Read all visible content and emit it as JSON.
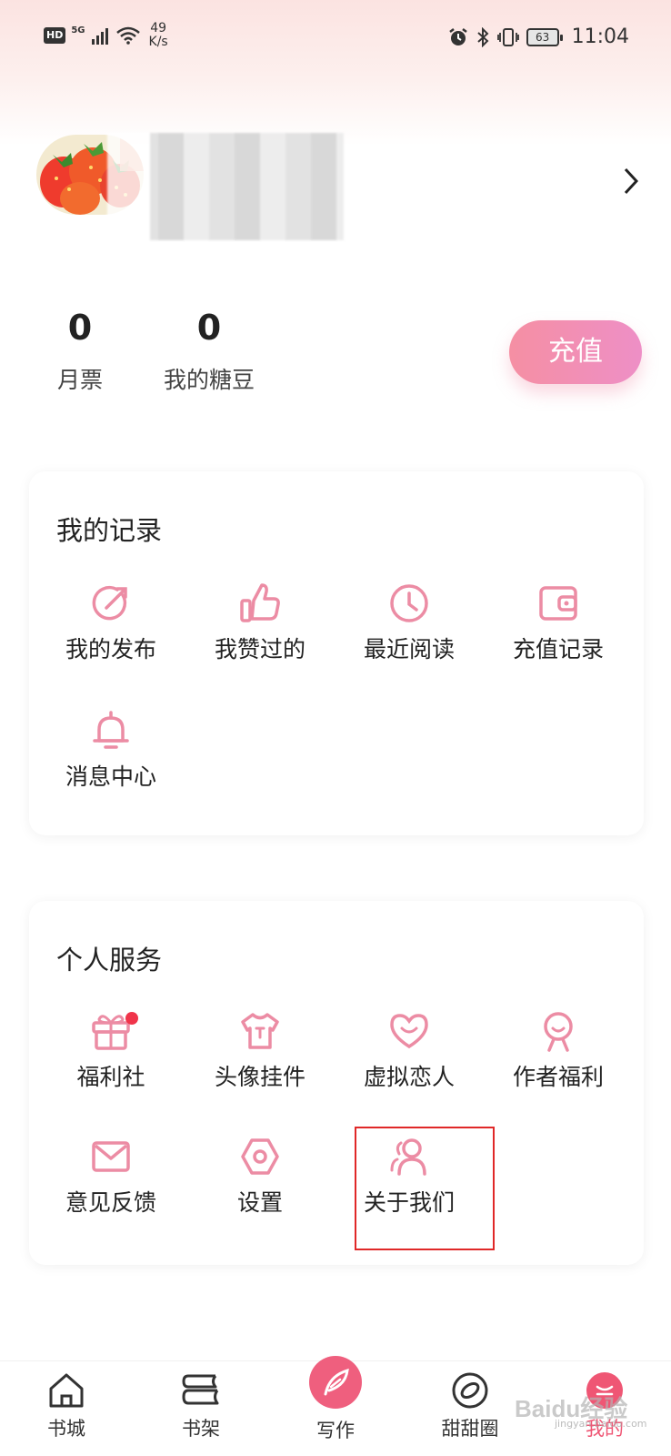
{
  "status_bar": {
    "hd": "HD",
    "network": "5G",
    "speed_value": "49",
    "speed_unit": "K/s",
    "battery": "63",
    "time": "11:04"
  },
  "profile": {
    "avatar_icon": "strawberry-avatar",
    "chevron_icon": "chevron-right-icon"
  },
  "stats": [
    {
      "value": "0",
      "label": "月票"
    },
    {
      "value": "0",
      "label": "我的糖豆"
    }
  ],
  "recharge_label": "充值",
  "records": {
    "title": "我的记录",
    "items": [
      {
        "label": "我的发布",
        "icon": "publish-icon"
      },
      {
        "label": "我赞过的",
        "icon": "thumbs-up-icon"
      },
      {
        "label": "最近阅读",
        "icon": "clock-icon"
      },
      {
        "label": "充值记录",
        "icon": "wallet-icon"
      },
      {
        "label": "消息中心",
        "icon": "bell-icon"
      }
    ]
  },
  "services": {
    "title": "个人服务",
    "items": [
      {
        "label": "福利社",
        "icon": "gift-icon",
        "badge": true
      },
      {
        "label": "头像挂件",
        "icon": "tshirt-icon"
      },
      {
        "label": "虚拟恋人",
        "icon": "heart-icon"
      },
      {
        "label": "作者福利",
        "icon": "person-icon"
      },
      {
        "label": "意见反馈",
        "icon": "mail-icon"
      },
      {
        "label": "设置",
        "icon": "settings-hex-icon"
      },
      {
        "label": "关于我们",
        "icon": "users-icon"
      }
    ]
  },
  "bottom_nav": {
    "items": [
      {
        "label": "书城",
        "icon": "home-icon"
      },
      {
        "label": "书架",
        "icon": "bookshelf-icon"
      },
      {
        "label": "写作",
        "icon": "feather-icon"
      },
      {
        "label": "甜甜圈",
        "icon": "donut-icon"
      },
      {
        "label": "我的",
        "icon": "profile-icon",
        "active": true
      }
    ]
  },
  "colors": {
    "accent": "#ef5674",
    "icon_pink": "#ec8ca4",
    "highlight": "#e02828"
  },
  "watermark": {
    "text": "Baidu经验",
    "sub": "jingyan.baidu.com"
  }
}
